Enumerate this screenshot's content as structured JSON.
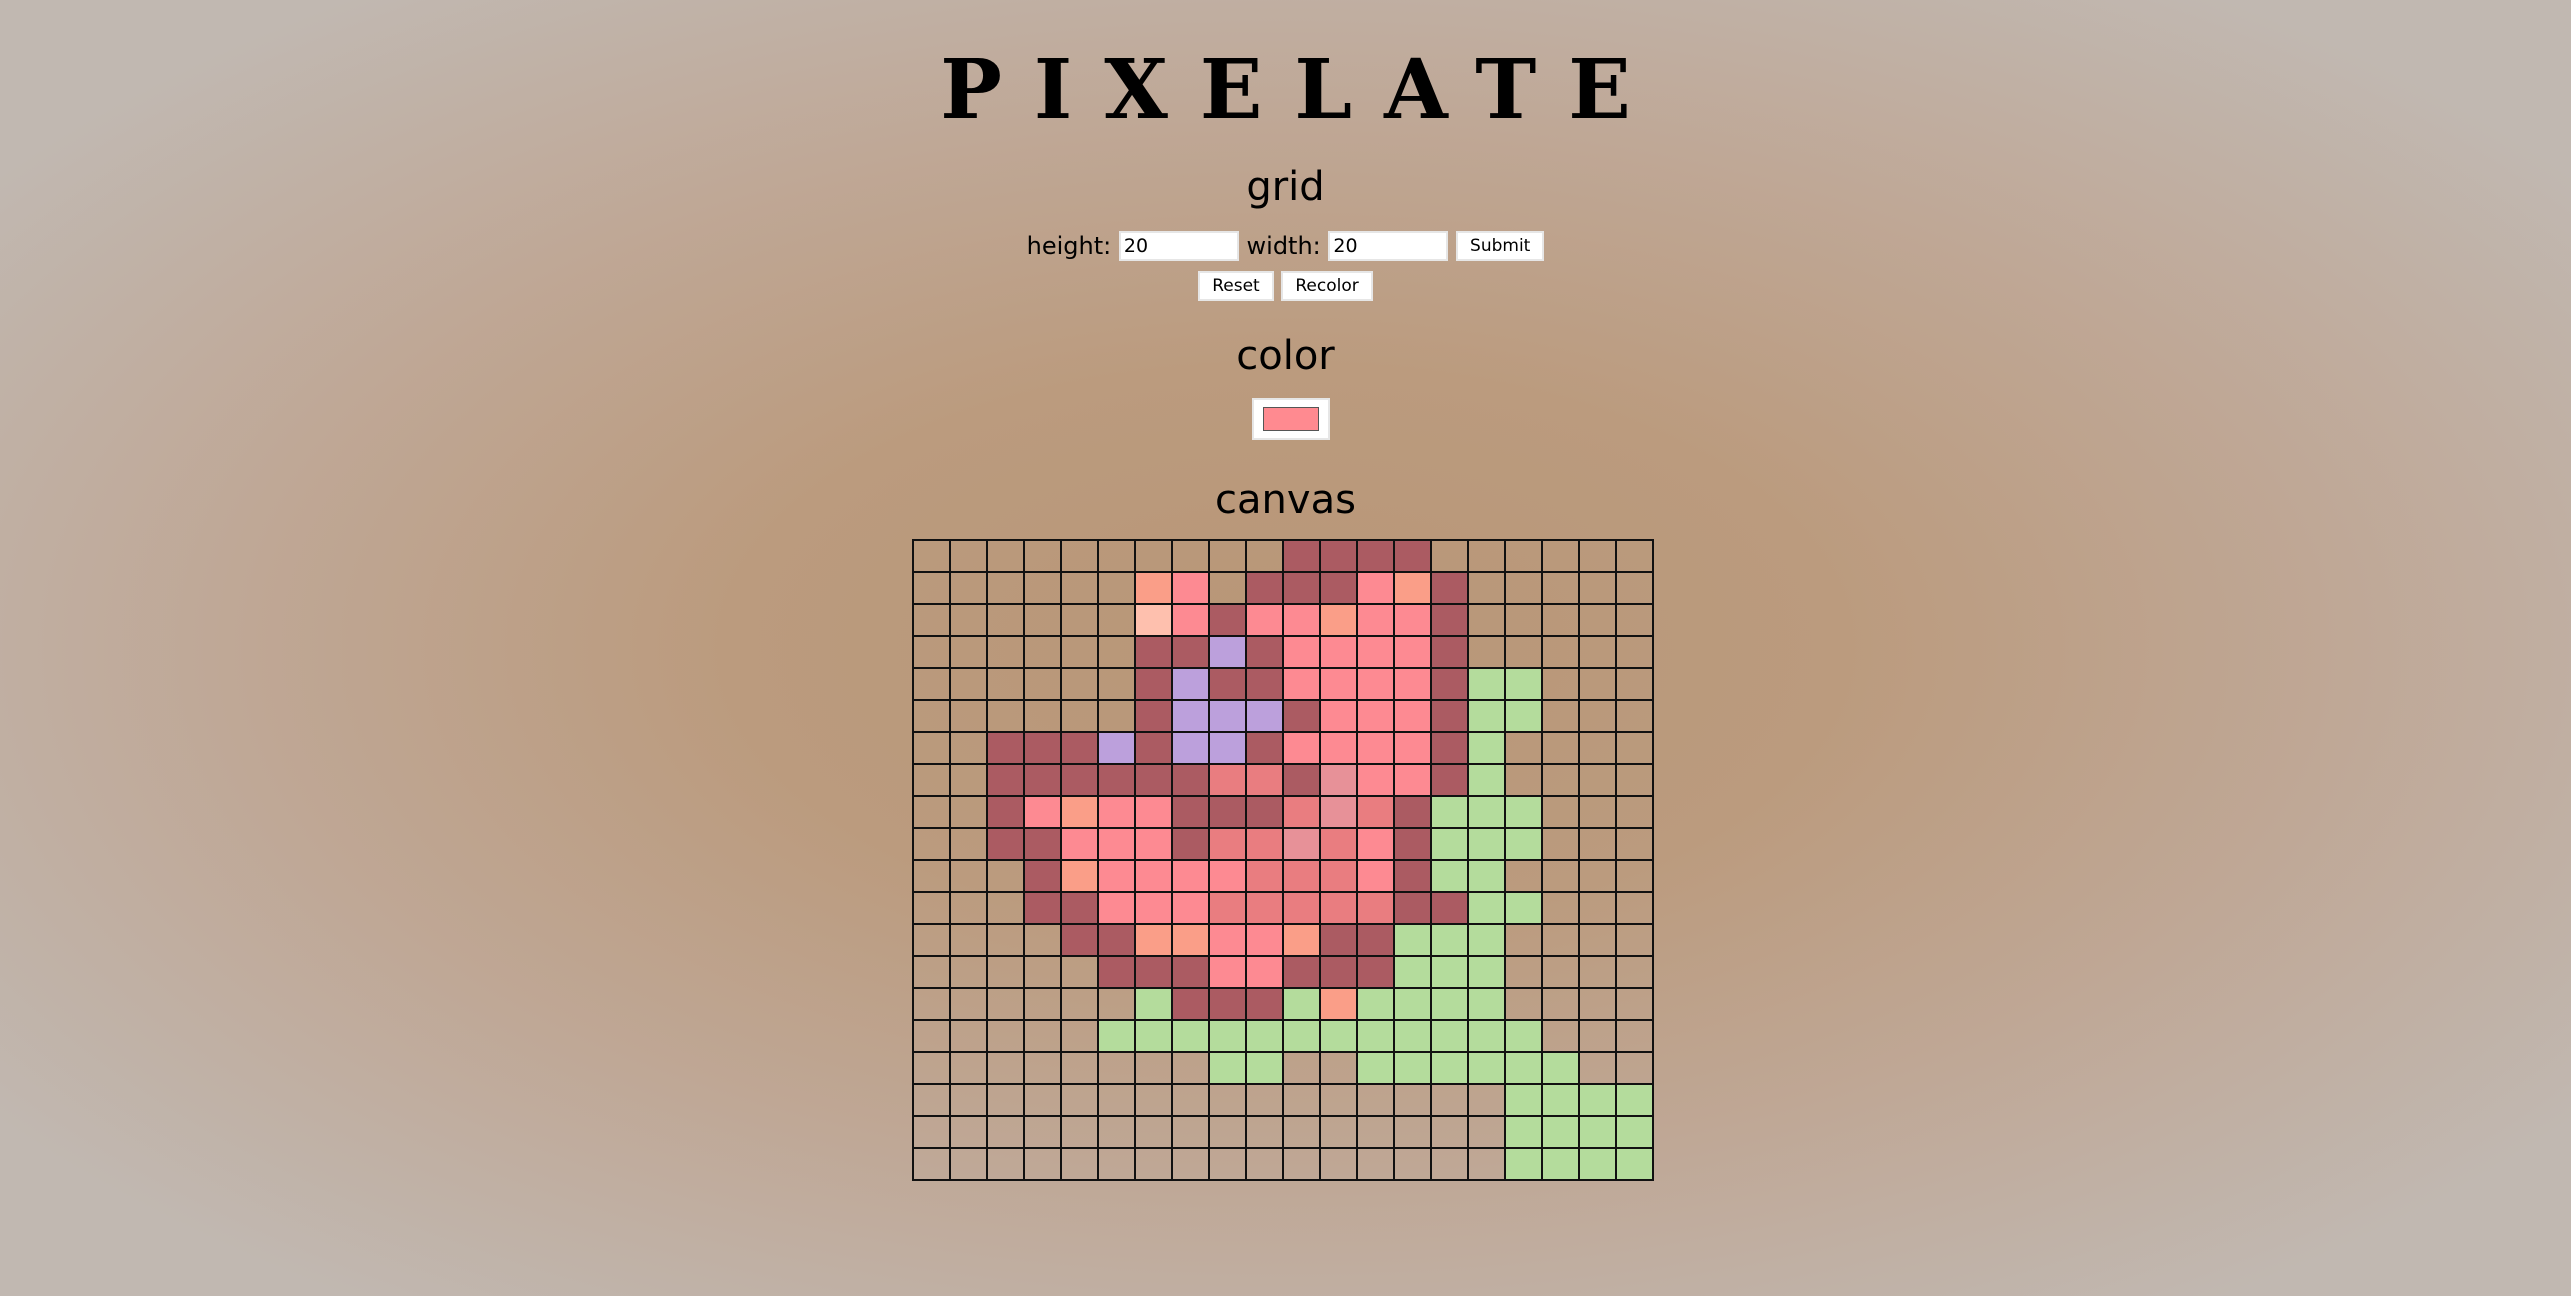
{
  "title": "PIXELATE",
  "grid": {
    "heading": "grid",
    "height_label": "height:",
    "height_value": "20",
    "width_label": "width:",
    "width_value": "20",
    "submit_label": "Submit",
    "reset_label": "Reset",
    "recolor_label": "Recolor"
  },
  "color": {
    "heading": "color",
    "selected": "#ff8a90"
  },
  "canvas": {
    "heading": "canvas",
    "rows": 20,
    "cols": 20,
    "palette": {
      ".": "",
      "D": "#ab5b62",
      "P": "#fd8a92",
      "O": "#fa9e88",
      "L": "#fec0ae",
      "V": "#bca0dc",
      "M": "#e97d80",
      "K": "#e79198",
      "G": "#b4dc9c"
    },
    "pixels": [
      "..........DDDD......",
      "......OP.DDDPOD.....",
      "......LPDPPOPPD.....",
      "......DDVDPPPPD.....",
      "......DVDDPPPPDGG...",
      "......DVVVDPPPDGG...",
      "..DDDVDVVDPPPPDG....",
      "..DDDDDDMMDKPPDG....",
      "..DPOPPDDDMKMDGGG...",
      "..DDPPPDMMKMPDGGG...",
      "...DOPPPPMMMPDGG....",
      "...DDPPPMMMMMDDGG...",
      "....DDOOPPODDGGG....",
      ".....DDDPPDDDGGG....",
      "......GDDDGOGGGG....",
      ".....GGGGGGGGGGGG...",
      "........GG..GGGGGG..",
      "................GGGG",
      "................GGGG",
      "................GGGG"
    ]
  }
}
